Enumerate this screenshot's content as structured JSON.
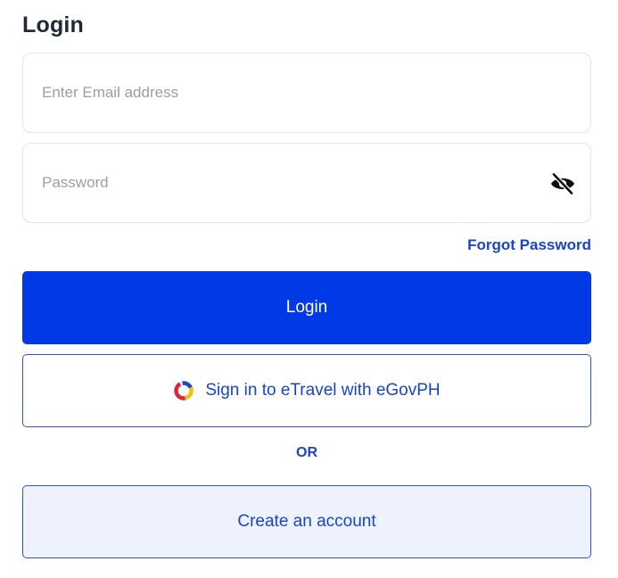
{
  "login_form": {
    "title": "Login",
    "email_placeholder": "Enter Email address",
    "email_value": "",
    "password_placeholder": "Password",
    "password_value": "",
    "password_toggle_icon": "eye-slash-icon",
    "forgot_password_label": "Forgot Password",
    "login_button_label": "Login",
    "egov_button_label": "Sign in to eTravel with eGovPH",
    "egov_logo_icon": "egovph-logo",
    "or_label": "OR",
    "create_account_label": "Create an account"
  },
  "colors": {
    "primary": "#0039e6",
    "link": "#1745c9",
    "create_bg": "#eef2fd",
    "input_border": "#e3e4e8"
  }
}
